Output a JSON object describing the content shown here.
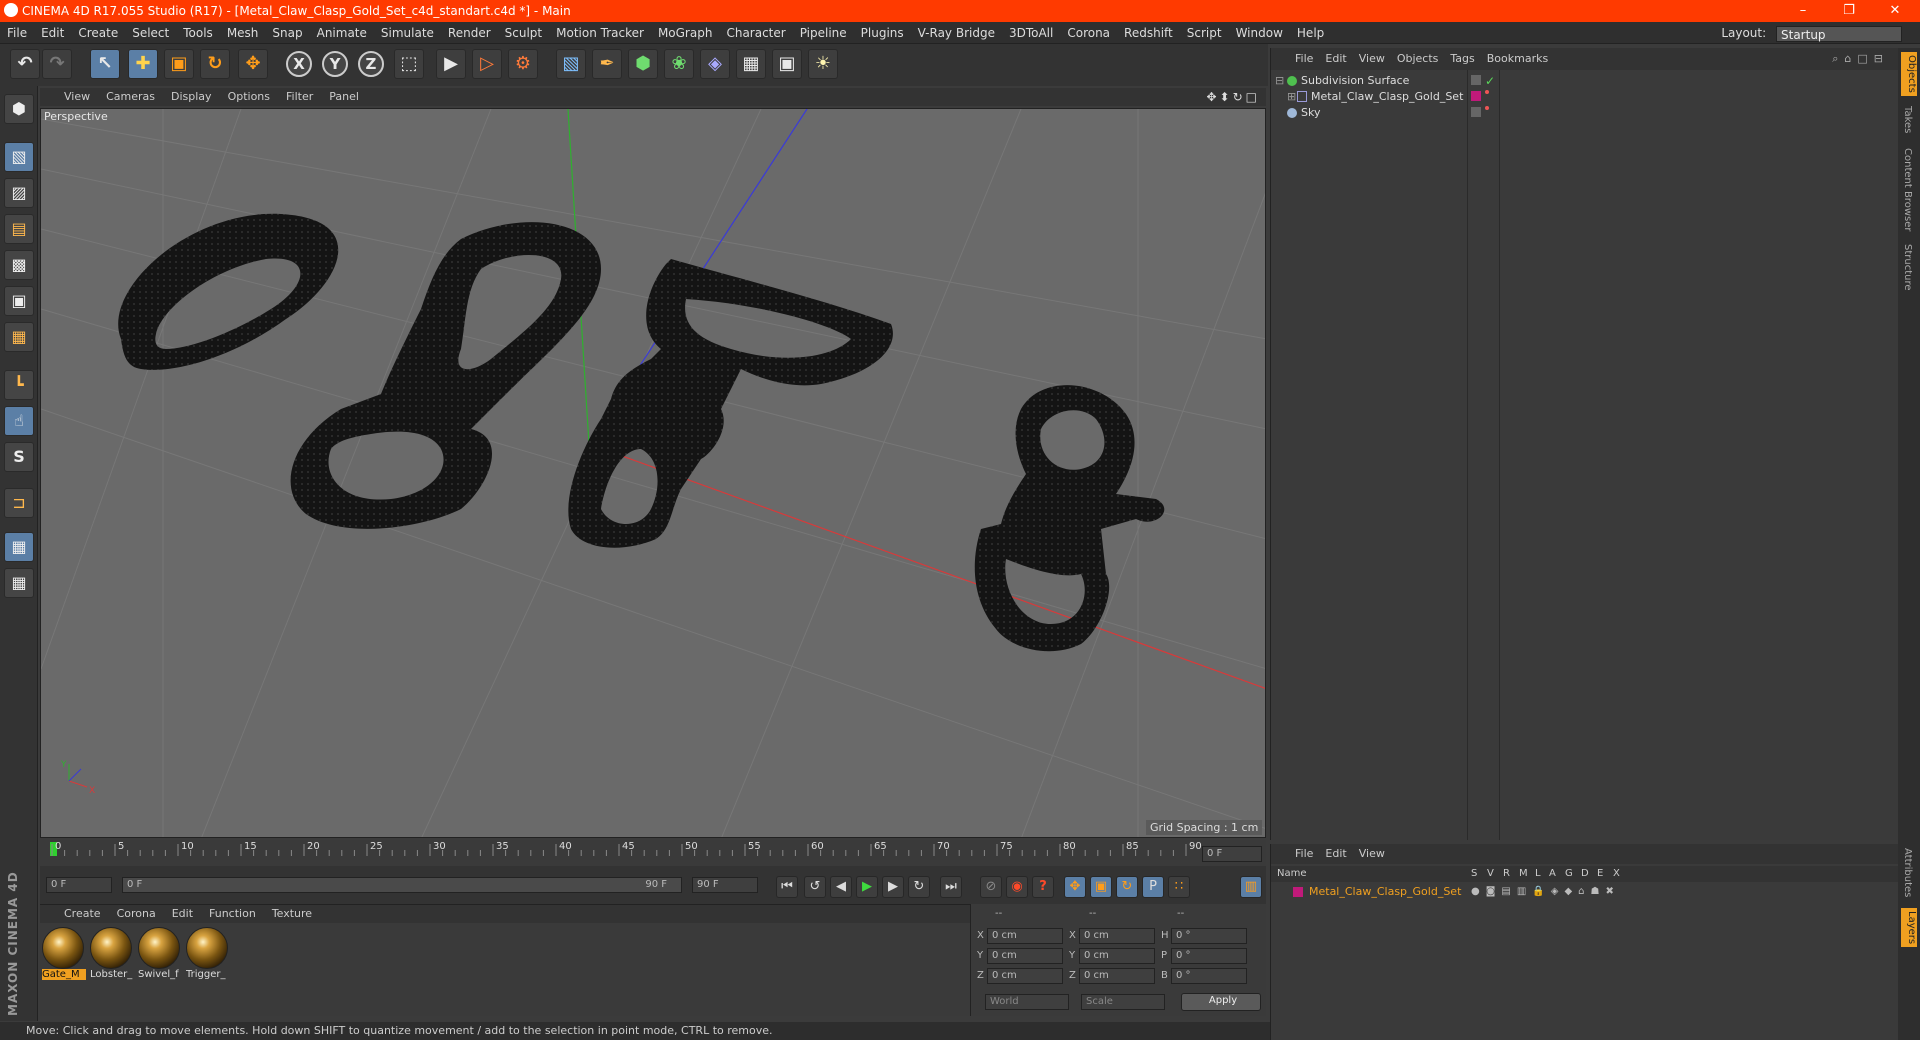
{
  "window": {
    "title": "CINEMA 4D R17.055 Studio (R17) - [Metal_Claw_Clasp_Gold_Set_c4d_standart.c4d *] - Main",
    "minimize": "–",
    "maximize": "❐",
    "close": "✕"
  },
  "menubar": {
    "items": [
      "File",
      "Edit",
      "Create",
      "Select",
      "Tools",
      "Mesh",
      "Snap",
      "Animate",
      "Simulate",
      "Render",
      "Sculpt",
      "Motion Tracker",
      "MoGraph",
      "Character",
      "Pipeline",
      "Plugins",
      "V-Ray Bridge",
      "3DToAll",
      "Corona",
      "Redshift",
      "Script",
      "Window",
      "Help"
    ],
    "layout_label": "Layout:",
    "layout_value": "Startup"
  },
  "toolbar": {
    "undo": "↶",
    "redo": "↷",
    "select": "↖",
    "move": "✚",
    "scale": "▣",
    "rotate": "↻",
    "last_tool": "✥",
    "axis_x": "X",
    "axis_y": "Y",
    "axis_z": "Z",
    "coord_system": "⬚",
    "render_view": "▶",
    "render_picture": "▷",
    "render_settings": "⚙",
    "cube": "▧",
    "pen": "✒",
    "subdiv": "⬢",
    "array": "❀",
    "deformer": "◈",
    "floor": "▦",
    "camera": "▣",
    "light": "☀"
  },
  "left_tools": [
    "⬢",
    "▧",
    "▨",
    "▤",
    "▩",
    "▣",
    "▦",
    "┗",
    "☝",
    "S",
    "⊐",
    "▦",
    "▦"
  ],
  "viewport": {
    "menu": [
      "View",
      "Cameras",
      "Display",
      "Options",
      "Filter",
      "Panel"
    ],
    "nav_icons": "✥⬍↻□",
    "label": "Perspective",
    "grid_spacing": "Grid Spacing : 1 cm",
    "axis_y": "Y",
    "axis_x": "X"
  },
  "timeline": {
    "ticks": [
      "0",
      "5",
      "10",
      "15",
      "20",
      "25",
      "30",
      "35",
      "40",
      "45",
      "50",
      "55",
      "60",
      "65",
      "70",
      "75",
      "80",
      "85",
      "90"
    ],
    "current_frame": "0 F"
  },
  "controls": {
    "start_frame": "0 F",
    "slider_start": "0 F",
    "slider_end": "90 F",
    "end_frame": "90 F",
    "goto_start": "⏮",
    "prev_key": "↺",
    "prev_frame": "◀",
    "play": "▶",
    "next_frame": "▶",
    "next_key": "↻",
    "goto_end": "⏭",
    "record_icons": [
      "⊘",
      "◉",
      "?",
      "✥",
      "▣",
      "↻",
      "P",
      "∷",
      "▥"
    ]
  },
  "material_manager": {
    "menu": [
      "Create",
      "Corona",
      "Edit",
      "Function",
      "Texture"
    ],
    "materials": [
      {
        "label": "Gate_M",
        "selected": true
      },
      {
        "label": "Lobster_",
        "selected": false
      },
      {
        "label": "Swivel_f",
        "selected": false
      },
      {
        "label": "Trigger_",
        "selected": false
      }
    ]
  },
  "coordinates": {
    "header": [
      "--",
      "--",
      "--"
    ],
    "rows": [
      {
        "a": "X",
        "av": "0 cm",
        "b": "X",
        "bv": "0 cm",
        "c": "H",
        "cv": "0 °"
      },
      {
        "a": "Y",
        "av": "0 cm",
        "b": "Y",
        "bv": "0 cm",
        "c": "P",
        "cv": "0 °"
      },
      {
        "a": "Z",
        "av": "0 cm",
        "b": "Z",
        "bv": "0 cm",
        "c": "B",
        "cv": "0 °"
      }
    ],
    "world": "World",
    "scale": "Scale",
    "apply": "Apply"
  },
  "object_manager": {
    "menu": [
      "File",
      "Edit",
      "View",
      "Objects",
      "Tags",
      "Bookmarks"
    ],
    "objects": [
      {
        "name": "Subdivision Surface",
        "color": "#7fd17f",
        "tag_color": "#5ab85a"
      },
      {
        "name": "Metal_Claw_Clasp_Gold_Set",
        "color": "#9a9ad8",
        "tag_color": "#c01a7a"
      },
      {
        "name": "Sky",
        "color": "#9fb8d8",
        "tag_color": ""
      }
    ],
    "check": "✓"
  },
  "layer_manager": {
    "menu": [
      "File",
      "Edit",
      "View"
    ],
    "columns": [
      "Name",
      "S",
      "V",
      "R",
      "M",
      "L",
      "A",
      "G",
      "D",
      "E",
      "X"
    ],
    "layer_name": "Metal_Claw_Clasp_Gold_Set",
    "layer_color": "#c01a7a"
  },
  "right_tabs": [
    "Objects",
    "Takes",
    "Content Browser",
    "Structure"
  ],
  "right_tabs_bottom": [
    "Attributes",
    "Layers"
  ],
  "branding": "MAXON CINEMA 4D",
  "status": "Move: Click and drag to move elements. Hold down SHIFT to quantize movement / add to the selection in point mode, CTRL to remove.",
  "colors": {
    "title_bar": "#ff3a00",
    "accent": "#f0a020",
    "active_tool": "#5b7fa6"
  }
}
